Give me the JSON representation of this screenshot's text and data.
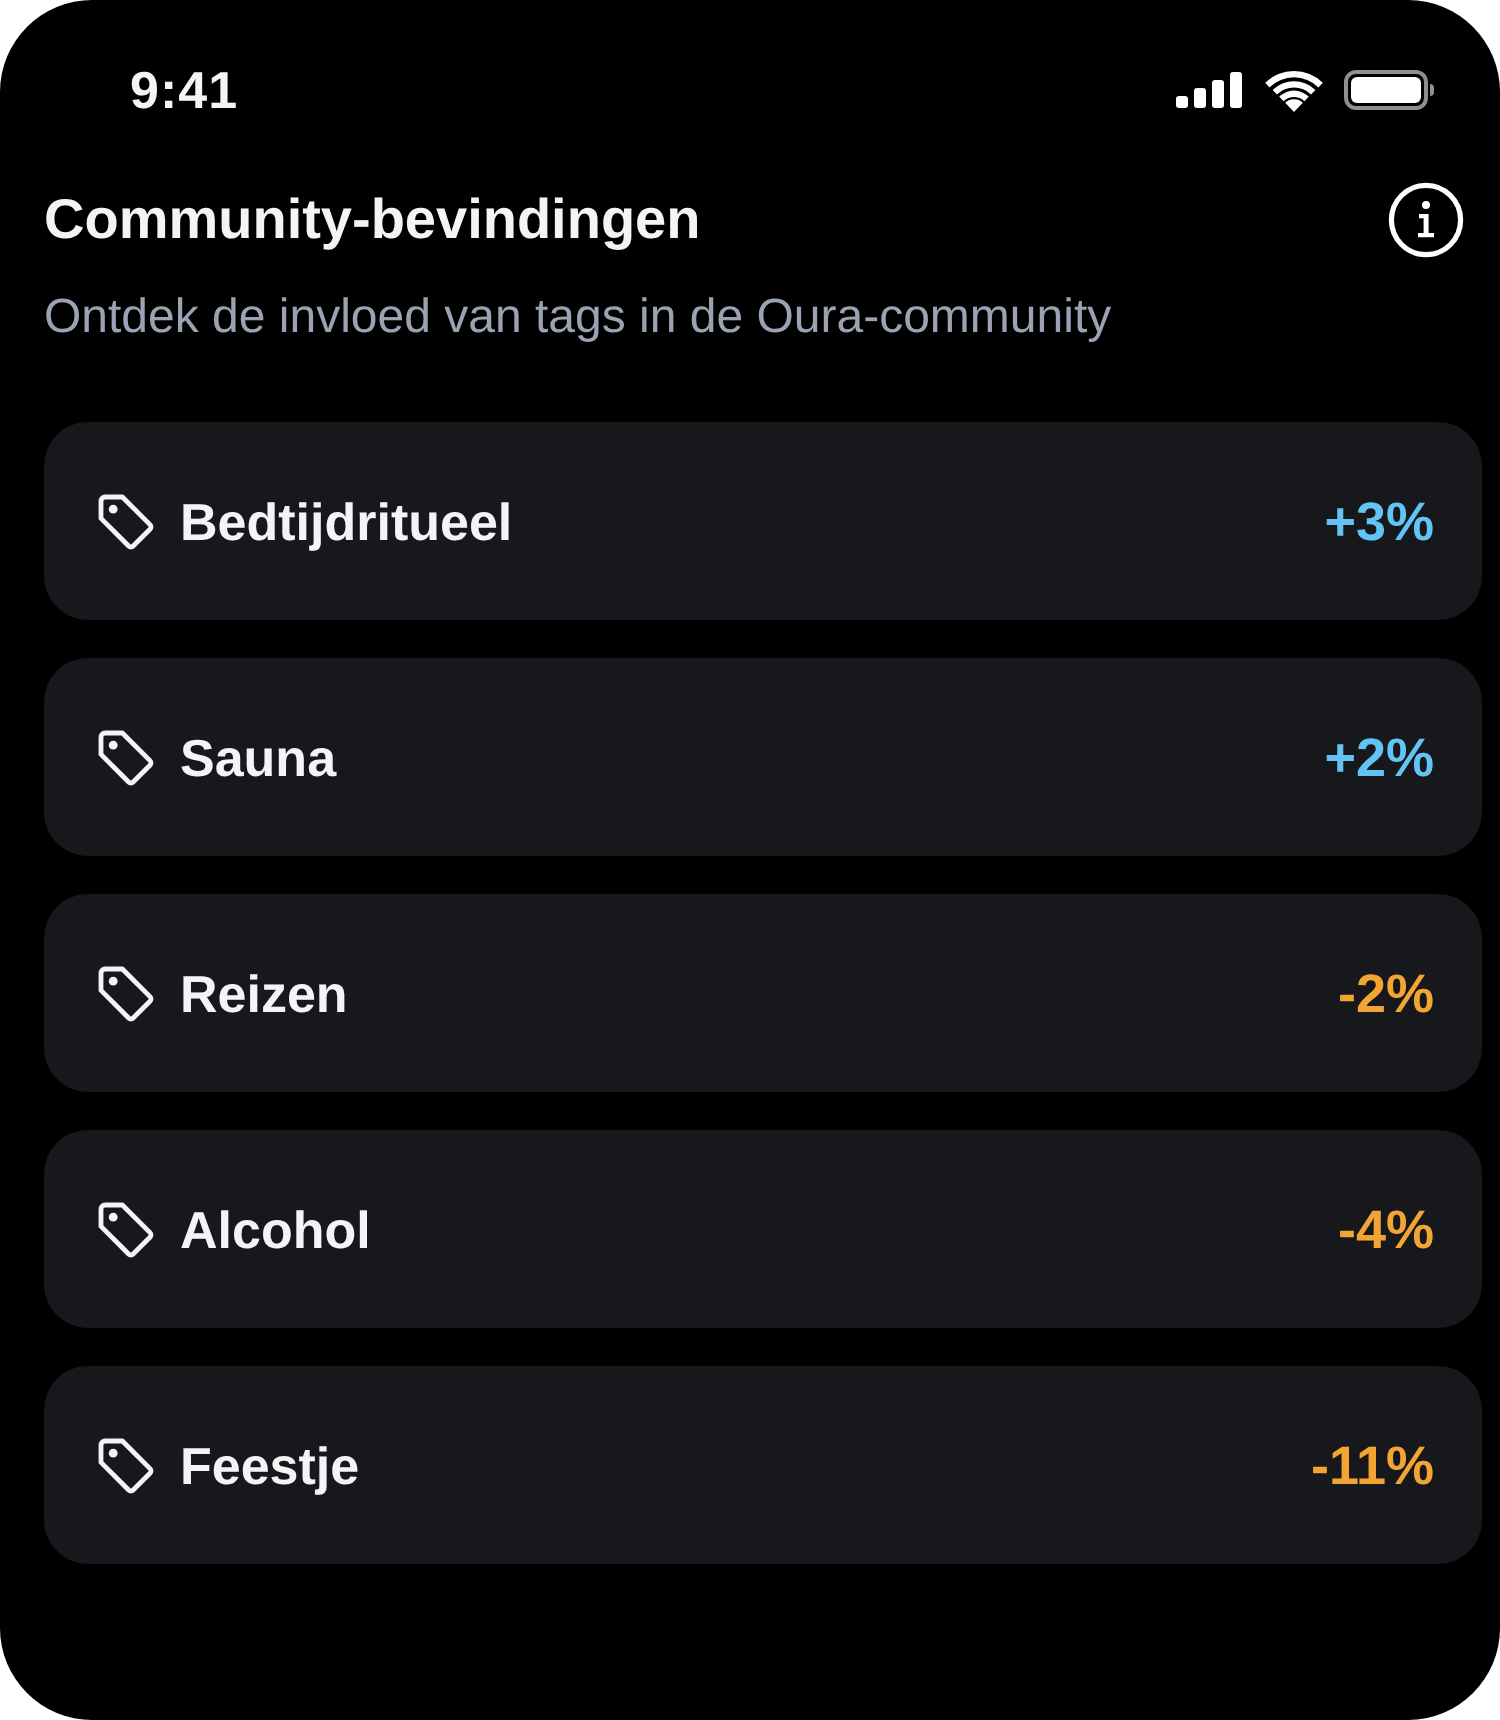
{
  "status_bar": {
    "time": "9:41"
  },
  "header": {
    "title": "Community-bevindingen",
    "subtitle": "Ontdek de invloed van tags in de Oura-community"
  },
  "tags": [
    {
      "label": "Bedtijdritueel",
      "change": "+3%",
      "color": "#62c4f5"
    },
    {
      "label": "Sauna",
      "change": "+2%",
      "color": "#62c4f5"
    },
    {
      "label": "Reizen",
      "change": "-2%",
      "color": "#f3a534"
    },
    {
      "label": "Alcohol",
      "change": "-4%",
      "color": "#f3a534"
    },
    {
      "label": "Feestje",
      "change": "-11%",
      "color": "#f3a534"
    }
  ]
}
